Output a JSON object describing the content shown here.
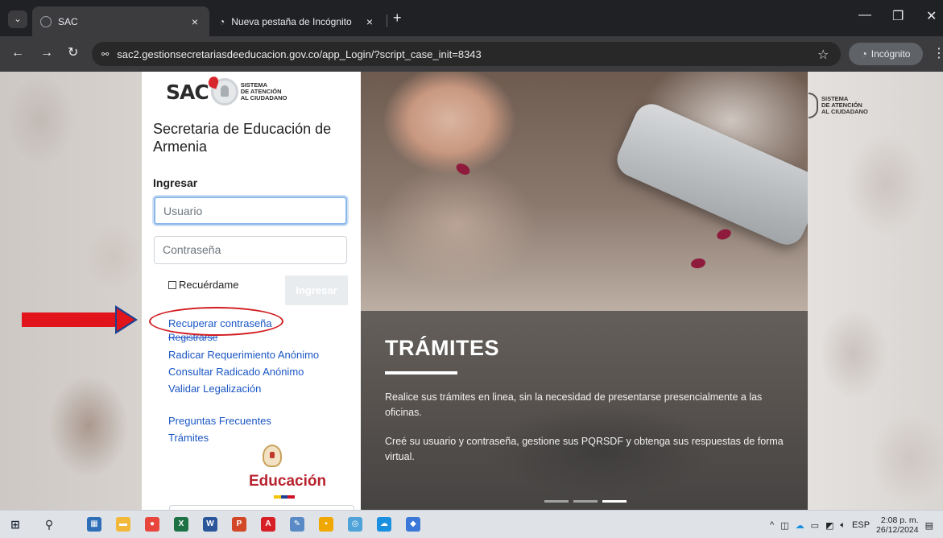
{
  "browser": {
    "tabs": [
      {
        "label": "SAC",
        "active": true
      },
      {
        "label": "Nueva pestaña de Incógnito",
        "active": false
      }
    ],
    "close_glyph": "×",
    "new_tab_glyph": "+",
    "url": "sac2.gestionsecretariasdeeducacion.gov.co/app_Login/?script_case_init=8343",
    "incognito_label": "Incógnito",
    "icons": {
      "tab_menu": "chevron-down-icon",
      "back": "back-arrow-icon",
      "forward": "forward-arrow-icon",
      "reload": "reload-icon",
      "site_info": "site-info-icon",
      "bookmark": "star-icon",
      "incognito": "incognito-icon",
      "menu": "kebab-menu-icon",
      "minimize": "minimize-icon",
      "restore": "restore-icon",
      "close": "close-icon"
    }
  },
  "login": {
    "logo_wordmark": "SAC",
    "logo_subtitle": [
      "SISTEMA",
      "DE ATENCIÓN",
      "AL CIUDADANO"
    ],
    "org_title": "Secretaria de Educación de Armenia",
    "heading": "Ingresar",
    "username_placeholder": "Usuario",
    "password_placeholder": "Contraseña",
    "remember_label": "Recuérdame",
    "submit_label": "Ingresar",
    "links": {
      "recover_password": "Recuperar contraseña",
      "register": "Registrarse",
      "anonymous_request": "Radicar Requerimiento Anónimo",
      "anonymous_lookup": "Consultar Radicado Anónimo",
      "validate_legalization": "Validar Legalización",
      "faq": "Preguntas Frecuentes",
      "procedures": "Trámites"
    },
    "ministry_label": "Educación",
    "flag_colors": [
      "#f5c400",
      "#1c3f94",
      "#ce1126"
    ]
  },
  "hero": {
    "title": "TRÁMITES",
    "paragraph_1": "Realice sus trámites en linea, sin la necesidad de presentarse presencialmente a las oficinas.",
    "paragraph_2": "Creé su usuario y contraseña, gestione sus PQRSDF y obtenga sus respuestas de forma virtual.",
    "carousel_slides": 3,
    "carousel_active": 3
  },
  "brand_corner": {
    "lines": [
      "SISTEMA",
      "DE ATENCIÓN",
      "AL CIUDADANO"
    ]
  },
  "annotation": {
    "arrow_color": "#e0141a",
    "circle_color": "#d21b1f"
  },
  "taskbar": {
    "pinned_apps": [
      {
        "name": "calculator-icon",
        "color": "#2f6fb8",
        "glyph": "▦"
      },
      {
        "name": "file-explorer-icon",
        "color": "#f2b83a",
        "glyph": "▬"
      },
      {
        "name": "chrome-icon",
        "color": "#e8453c",
        "glyph": "●"
      },
      {
        "name": "excel-icon",
        "color": "#1e7145",
        "glyph": "X"
      },
      {
        "name": "word-icon",
        "color": "#2b579a",
        "glyph": "W"
      },
      {
        "name": "powerpoint-icon",
        "color": "#d24726",
        "glyph": "P"
      },
      {
        "name": "acrobat-icon",
        "color": "#d71f26",
        "glyph": "A"
      },
      {
        "name": "paint-icon",
        "color": "#5a8ac6",
        "glyph": "✎"
      },
      {
        "name": "sticky-notes-icon",
        "color": "#f0a800",
        "glyph": "▪"
      },
      {
        "name": "magnifier-icon",
        "color": "#4fa3d9",
        "glyph": "◎"
      },
      {
        "name": "onedrive-icon",
        "color": "#1b8fe0",
        "glyph": "☁"
      },
      {
        "name": "edit-app-icon",
        "color": "#3c78d8",
        "glyph": "◆"
      }
    ],
    "language": "ESP",
    "time": "2:08 p. m.",
    "date": "26/12/2024"
  }
}
